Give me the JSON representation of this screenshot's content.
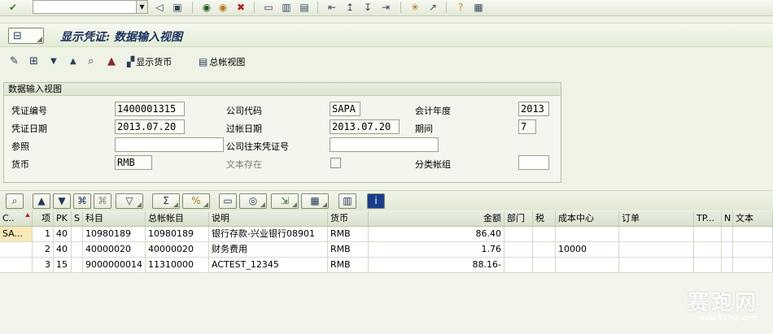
{
  "toolbar": {
    "command_field": "",
    "icons": [
      "check-icon",
      "back-icon",
      "save-icon",
      "exit-icon",
      "cancel-icon",
      "print-icon",
      "find-icon",
      "find-next-icon",
      "first-page-icon",
      "prev-page-icon",
      "next-page-icon",
      "last-page-icon",
      "new-session-icon",
      "shortcut-icon",
      "help-icon",
      "layout-icon"
    ]
  },
  "title": "显示凭证: 数据输入视图",
  "app_toolbar": {
    "display_currency": "显示货币",
    "gl_view": "总帐视图"
  },
  "header": {
    "group_title": "数据输入视图",
    "doc_number_label": "凭证编号",
    "doc_number": "1400001315",
    "company_code_label": "公司代码",
    "company_code": "SAPA",
    "fiscal_year_label": "会计年度",
    "fiscal_year": "2013",
    "doc_date_label": "凭证日期",
    "doc_date": "2013.07.20",
    "posting_date_label": "过帐日期",
    "posting_date": "2013.07.20",
    "period_label": "期间",
    "period": "7",
    "reference_label": "参照",
    "reference": "",
    "intercompany_label": "公司往来凭证号",
    "intercompany": "",
    "currency_label": "货币",
    "currency": "RMB",
    "text_exists_label": "文本存在",
    "ledger_group_label": "分类帐组",
    "ledger_group": ""
  },
  "grid": {
    "columns": [
      "C..",
      "项",
      "PK",
      "S",
      "科目",
      "总帐帐目",
      "说明",
      "货币",
      "金额",
      "部门",
      "税",
      "成本中心",
      "订单",
      "TP...",
      "N",
      "文本"
    ],
    "rows": [
      {
        "c": "SA...",
        "item": "1",
        "pk": "40",
        "s": "",
        "account": "10980189",
        "gl_account": "10980189",
        "desc": "银行存款-兴业银行08901",
        "currency": "RMB",
        "amount": "86.40",
        "dept": "",
        "tax": "",
        "cost_center": "",
        "order": "",
        "tp": "",
        "n": "",
        "text": ""
      },
      {
        "c": "",
        "item": "2",
        "pk": "40",
        "s": "",
        "account": "40000020",
        "gl_account": "40000020",
        "desc": "财务费用",
        "currency": "RMB",
        "amount": "1.76",
        "dept": "",
        "tax": "",
        "cost_center": "10000",
        "order": "",
        "tp": "",
        "n": "",
        "text": ""
      },
      {
        "c": "",
        "item": "3",
        "pk": "15",
        "s": "",
        "account": "9000000014",
        "gl_account": "11310000",
        "desc": "ACTEST_12345",
        "currency": "RMB",
        "amount": "88.16-",
        "dept": "",
        "tax": "",
        "cost_center": "",
        "order": "",
        "tp": "",
        "n": "",
        "text": ""
      }
    ]
  },
  "watermark": {
    "logo": "赛跑网",
    "url": "www.915sp.com"
  }
}
